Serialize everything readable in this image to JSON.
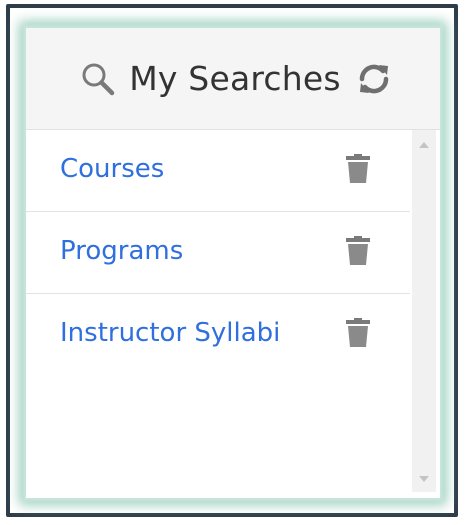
{
  "panel": {
    "title": "My Searches",
    "icons": {
      "search": "search-icon",
      "refresh": "refresh-icon",
      "delete": "trash-icon"
    }
  },
  "searches": [
    {
      "label": "Courses"
    },
    {
      "label": "Programs"
    },
    {
      "label": "Instructor Syllabi"
    }
  ],
  "colors": {
    "link": "#2f6fde",
    "frame_border": "#2f3d49",
    "glow": "#9fd0c0",
    "header_bg": "#f5f5f5",
    "icon_gray": "#7a7a7a"
  }
}
